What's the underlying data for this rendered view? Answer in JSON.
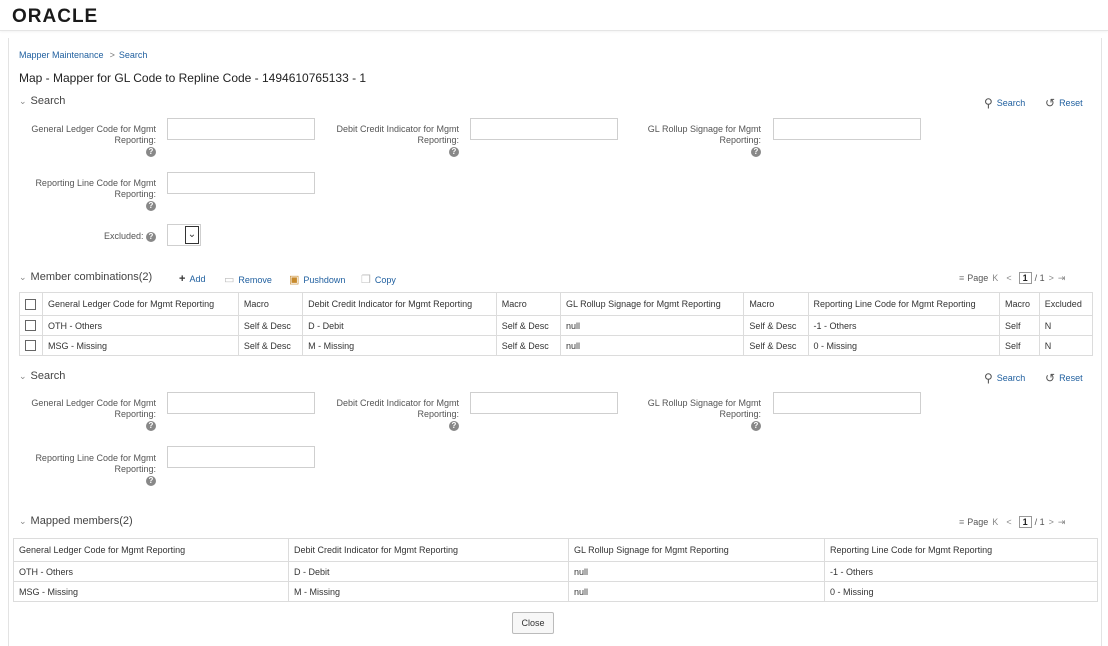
{
  "app": {
    "logo": "ORACLE"
  },
  "breadcrumb": {
    "parent": "Mapper Maintenance",
    "separator": ">",
    "current": "Search"
  },
  "page": {
    "title": "Map - Mapper for GL Code to Repline Code - 1494610765133 - 1"
  },
  "search1": {
    "title": "Search",
    "search_label": "Search",
    "reset_label": "Reset",
    "fields": {
      "gl_code_l1": "General Ledger Code for Mgmt",
      "gl_code_l2": "Reporting:",
      "dc_l1": "Debit Credit Indicator for Mgmt",
      "dc_l2": "Reporting:",
      "rollup_l1": "GL Rollup Signage for Mgmt",
      "rollup_l2": "Reporting:",
      "repline_l1": "Reporting Line Code for Mgmt",
      "repline_l2": "Reporting:",
      "excluded": "Excluded:"
    }
  },
  "member_combinations": {
    "title": "Member combinations(2)",
    "toolbar": {
      "add": "Add",
      "remove": "Remove",
      "pushdown": "Pushdown",
      "copy": "Copy"
    },
    "pager": {
      "label": "Page",
      "current": "1",
      "total": "/ 1"
    },
    "columns": [
      "General Ledger Code for Mgmt Reporting",
      "Macro",
      "Debit Credit Indicator for Mgmt Reporting",
      "Macro",
      "GL Rollup Signage for Mgmt Reporting",
      "Macro",
      "Reporting Line Code for Mgmt Reporting",
      "Macro",
      "Excluded"
    ],
    "rows": [
      [
        "OTH - Others",
        "Self & Desc",
        "D - Debit",
        "Self & Desc",
        "null",
        "Self & Desc",
        "-1 - Others",
        "Self",
        "N"
      ],
      [
        "MSG - Missing",
        "Self & Desc",
        "M - Missing",
        "Self & Desc",
        "null",
        "Self & Desc",
        "0 - Missing",
        "Self",
        "N"
      ]
    ]
  },
  "search2": {
    "title": "Search",
    "search_label": "Search",
    "reset_label": "Reset",
    "fields": {
      "gl_code_l1": "General Ledger Code for Mgmt",
      "gl_code_l2": "Reporting:",
      "dc_l1": "Debit Credit Indicator for Mgmt",
      "dc_l2": "Reporting:",
      "rollup_l1": "GL Rollup Signage for Mgmt",
      "rollup_l2": "Reporting:",
      "repline_l1": "Reporting Line Code for Mgmt",
      "repline_l2": "Reporting:"
    }
  },
  "mapped_members": {
    "title": "Mapped members(2)",
    "pager": {
      "label": "Page",
      "current": "1",
      "total": "/ 1"
    },
    "columns": [
      "General Ledger Code for Mgmt Reporting",
      "Debit Credit Indicator for Mgmt Reporting",
      "GL Rollup Signage for Mgmt Reporting",
      "Reporting Line Code for Mgmt Reporting"
    ],
    "rows": [
      [
        "OTH - Others",
        "D - Debit",
        "null",
        "-1 - Others"
      ],
      [
        "MSG - Missing",
        "M - Missing",
        "null",
        "0 - Missing"
      ]
    ]
  },
  "footer": {
    "close_label": "Close"
  },
  "icons": {
    "search": "magnifier-icon",
    "reset": "reset-icon",
    "help": "help-icon",
    "add": "plus-icon",
    "remove": "trash-icon",
    "pushdown": "pushdown-icon",
    "copy": "copy-icon"
  },
  "colors": {
    "link": "#1f5f9f",
    "border": "#dcdcdc"
  }
}
